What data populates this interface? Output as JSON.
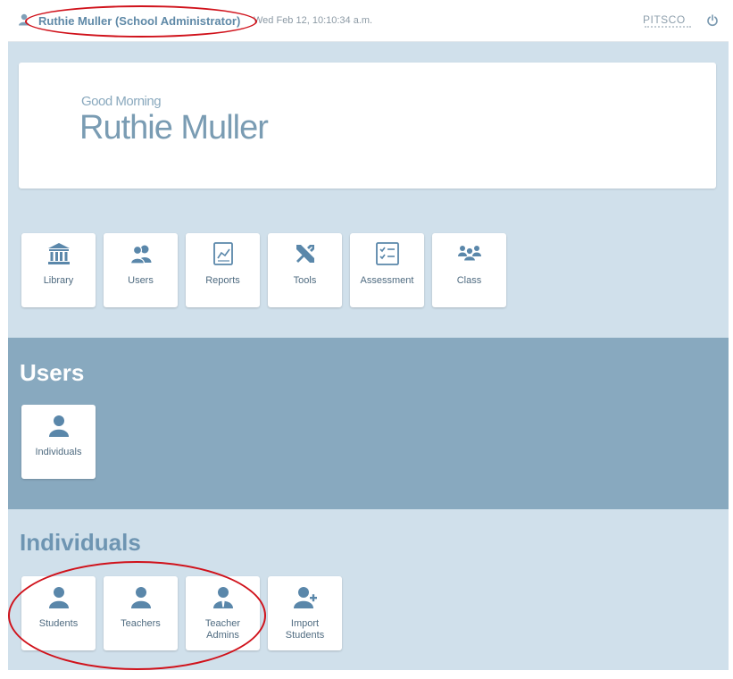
{
  "header": {
    "user_name": "Ruthie Muller (School Administrator)",
    "datetime": "Wed Feb 12,  10:10:34 a.m.",
    "brand": "PITSCO",
    "icons": [
      "user-icon",
      "power-icon"
    ]
  },
  "greeting": {
    "salutation": "Good Morning",
    "name": "Ruthie Muller"
  },
  "nav_tiles": [
    {
      "label": "Library",
      "icon": "library-icon"
    },
    {
      "label": "Users",
      "icon": "users-icon"
    },
    {
      "label": "Reports",
      "icon": "reports-icon"
    },
    {
      "label": "Tools",
      "icon": "tools-icon"
    },
    {
      "label": "Assessment",
      "icon": "assessment-icon"
    },
    {
      "label": "Class",
      "icon": "class-icon"
    }
  ],
  "users_section": {
    "title": "Users",
    "tiles": [
      {
        "label": "Individuals",
        "icon": "person-icon"
      }
    ]
  },
  "individuals_section": {
    "title": "Individuals",
    "tiles": [
      {
        "label": "Students",
        "icon": "person-icon"
      },
      {
        "label": "Teachers",
        "icon": "person-icon"
      },
      {
        "label": "Teacher Admins",
        "icon": "person-tie-icon"
      },
      {
        "label": "Import Students",
        "icon": "person-add-icon"
      }
    ]
  },
  "colors": {
    "background": "#d0e0eb",
    "band": "#88a9bf",
    "accent": "#5f89a7",
    "annotation": "#d0121b"
  }
}
